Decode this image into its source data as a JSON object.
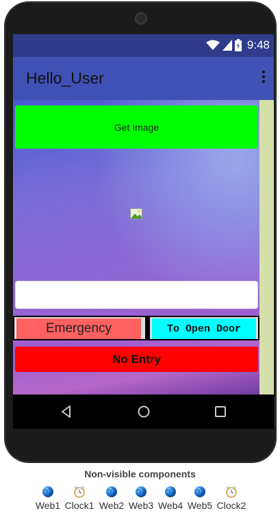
{
  "status_bar": {
    "time": "9:48"
  },
  "app_bar": {
    "title": "Hello_User"
  },
  "buttons": {
    "get_image": "Get Image",
    "emergency": "Emergency",
    "open_door": "To Open Door",
    "no_entry": "No Entry"
  },
  "textbox": {
    "value": ""
  },
  "colors": {
    "app_bar": "#3f51b5",
    "status_bar": "#2f3c8c",
    "get_image_bg": "#00ff00",
    "emergency_bg": "#ff6060",
    "open_door_bg": "#00ffff",
    "no_entry_bg": "#ff0000"
  },
  "non_visible": {
    "title": "Non-visible components",
    "components": [
      {
        "label": "Web1",
        "icon": "globe-icon"
      },
      {
        "label": "Clock1",
        "icon": "clock-icon"
      },
      {
        "label": "Web2",
        "icon": "globe-icon"
      },
      {
        "label": "Web3",
        "icon": "globe-icon"
      },
      {
        "label": "Web4",
        "icon": "globe-icon"
      },
      {
        "label": "Web5",
        "icon": "globe-icon"
      },
      {
        "label": "Clock2",
        "icon": "clock-icon"
      }
    ]
  }
}
